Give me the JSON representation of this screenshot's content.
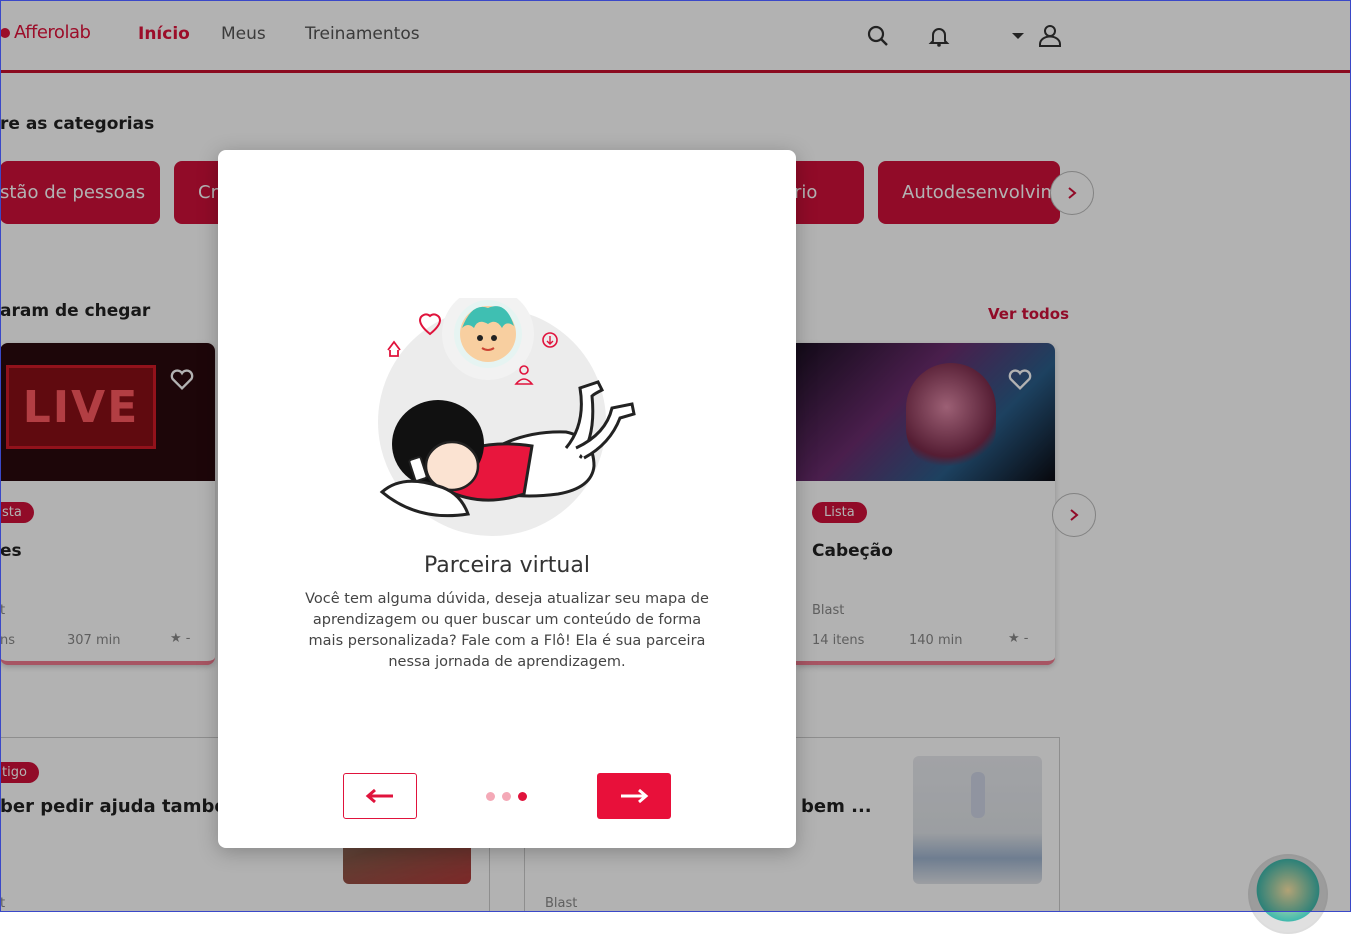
{
  "header": {
    "logo": "Afferolab",
    "nav": [
      "Início",
      "Meus",
      "Treinamentos"
    ]
  },
  "categories": {
    "title": "re as categorias",
    "items": [
      "stão de pessoas",
      "Cr",
      "rio",
      "Autodesenvolvim"
    ]
  },
  "arrivals": {
    "title": "aram de chegar",
    "see_all": "Ver todos",
    "cards": [
      {
        "badge": "sta",
        "title": "es",
        "author": "t",
        "items": "ns",
        "duration": "307 min",
        "rating": "★ -",
        "thumb_text": "LIVE"
      },
      {
        "badge": "Lista",
        "title": "Cabeção",
        "author": "Blast",
        "items": "14 itens",
        "duration": "140 min",
        "rating": "★ -"
      }
    ]
  },
  "articles": {
    "cards": [
      {
        "badge": "tigo",
        "title": "ber pedir ajuda també",
        "author": "t"
      },
      {
        "title": "bem ...",
        "author": "Blast"
      }
    ]
  },
  "modal": {
    "title": "Parceira virtual",
    "body": "Você tem alguma dúvida, deseja atualizar seu mapa de aprendizagem ou quer buscar um conteúdo de forma mais personalizada? Fale com a Flô! Ela é sua parceira nessa jornada de aprendizagem.",
    "steps_total": 3,
    "current_step": 3
  },
  "colors": {
    "brand": "#e0133c",
    "brand_dark": "#d0103a",
    "overlay": "rgba(0,0,0,0.30)"
  }
}
